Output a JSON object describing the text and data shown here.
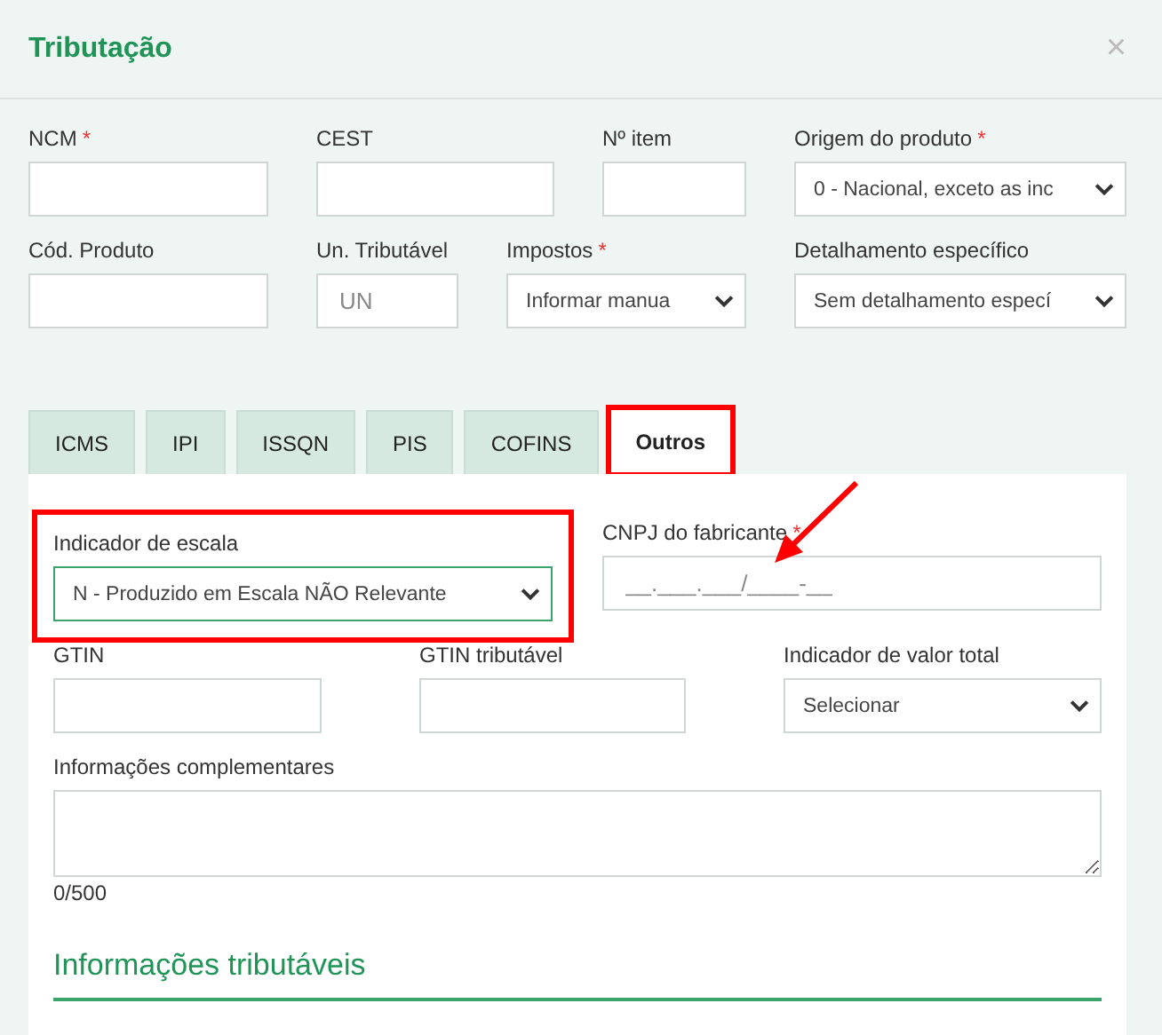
{
  "dialog": {
    "title": "Tributação",
    "close": "×"
  },
  "rows": [
    [
      {
        "label": "NCM",
        "required": "*",
        "kind": "input"
      },
      {
        "label": "CEST",
        "kind": "input"
      },
      {
        "label": "Nº item",
        "kind": "input"
      },
      {
        "label": "Origem do produto",
        "required": "*",
        "kind": "select",
        "value": "0 - Nacional, exceto as inc"
      }
    ],
    [
      {
        "label": "Cód. Produto",
        "kind": "input"
      },
      {
        "label": "Un. Tributável",
        "kind": "input",
        "placeholder": "UN"
      },
      {
        "label": "Impostos",
        "required": "*",
        "kind": "select",
        "value": "Informar manua"
      },
      {
        "label": "Detalhamento específico",
        "kind": "select",
        "value": "Sem detalhamento especí"
      }
    ]
  ],
  "tabs": [
    {
      "label": "ICMS",
      "selected": false,
      "highlighted": false
    },
    {
      "label": "IPI",
      "selected": false,
      "highlighted": false
    },
    {
      "label": "ISSQN",
      "selected": false,
      "highlighted": false
    },
    {
      "label": "PIS",
      "selected": false,
      "highlighted": false
    },
    {
      "label": "COFINS",
      "selected": false,
      "highlighted": false
    },
    {
      "label": "Outros",
      "selected": true,
      "highlighted": true
    }
  ],
  "panel": {
    "rows": [
      [
        {
          "label": "Indicador de escala",
          "kind": "select",
          "value": "N - Produzido em Escala NÃO Relevante",
          "focused": true,
          "highlighted": true
        },
        {
          "label": "CNPJ do fabricante",
          "required": "*",
          "kind": "input",
          "placeholder": "__.___.___/____-__"
        }
      ],
      [
        {
          "label": "GTIN",
          "kind": "input"
        },
        {
          "label": "GTIN tributável",
          "kind": "input"
        },
        {
          "label": "Indicador de valor total",
          "kind": "select",
          "value": "Selecionar"
        }
      ]
    ],
    "notes": {
      "label": "Informações complementares",
      "counter": "0/500"
    },
    "section_title": "Informações tributáveis"
  }
}
